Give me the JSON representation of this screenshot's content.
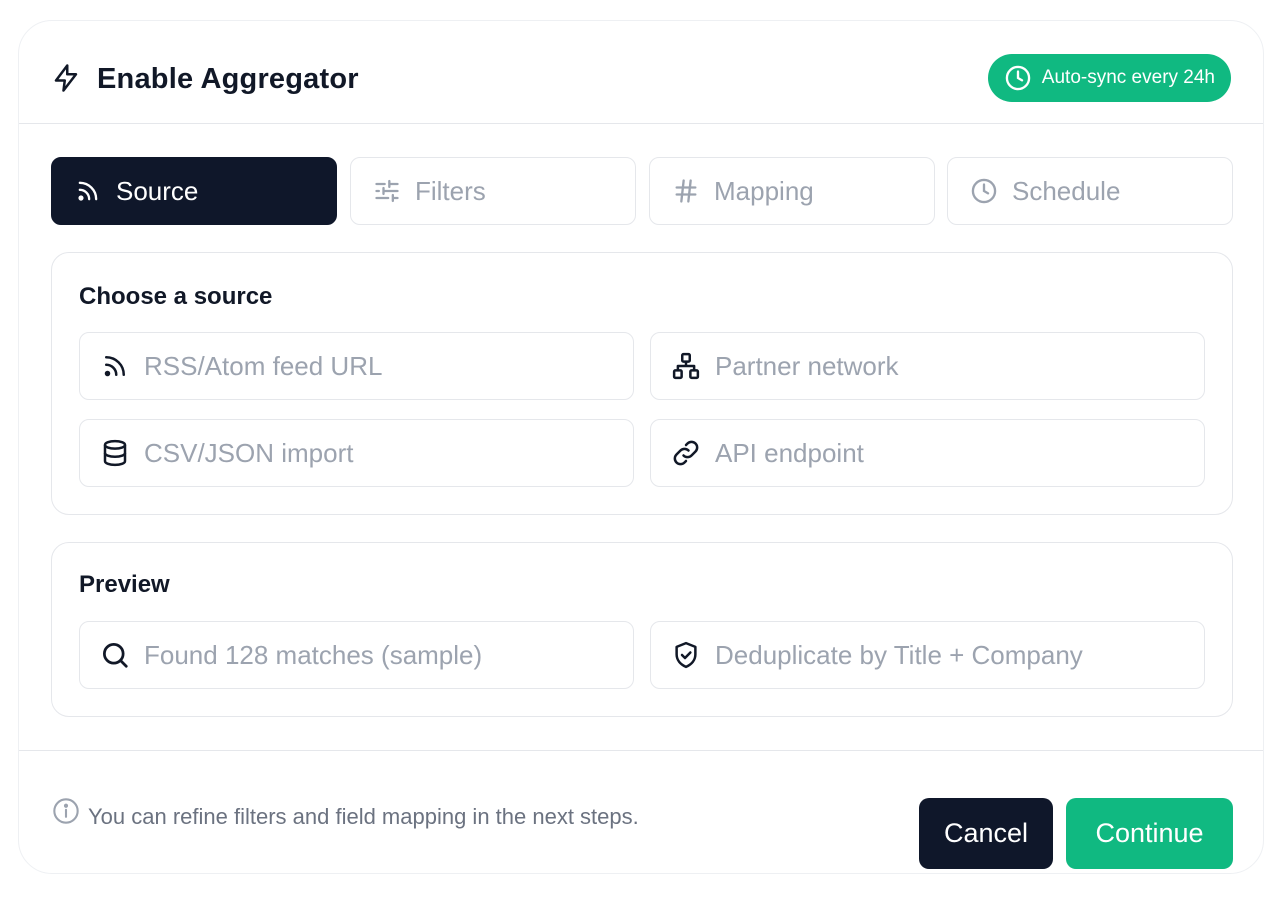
{
  "dialog": {
    "title": "Enable Aggregator",
    "title_icon": "bolt-icon",
    "badge": {
      "icon": "clock-icon",
      "label": "Auto-sync every 24h"
    }
  },
  "tabs": [
    {
      "label": "Source",
      "icon": "rss-icon",
      "active": true
    },
    {
      "label": "Filters",
      "icon": "sliders-icon",
      "active": false
    },
    {
      "label": "Mapping",
      "icon": "hash-icon",
      "active": false
    },
    {
      "label": "Schedule",
      "icon": "clock-icon",
      "active": false
    }
  ],
  "source": {
    "title": "Choose a source",
    "options": [
      {
        "label": "RSS/Atom feed URL",
        "icon": "rss-icon"
      },
      {
        "label": "Partner network",
        "icon": "network-icon"
      },
      {
        "label": "CSV/JSON import",
        "icon": "database-icon"
      },
      {
        "label": "API endpoint",
        "icon": "link-icon"
      }
    ]
  },
  "preview": {
    "title": "Preview",
    "items": [
      {
        "label": "Found 128 matches (sample)",
        "icon": "search-icon"
      },
      {
        "label": "Deduplicate by Title + Company",
        "icon": "shield-check-icon"
      }
    ]
  },
  "footer": {
    "hint_icon": "info-icon",
    "hint": "You can refine filters and field mapping in the next steps.",
    "cancel_label": "Cancel",
    "continue_label": "Continue"
  },
  "colors": {
    "accent": "#10b981",
    "dark": "#0f172a",
    "muted_text": "#9ca3af",
    "border": "#e5e7eb"
  }
}
